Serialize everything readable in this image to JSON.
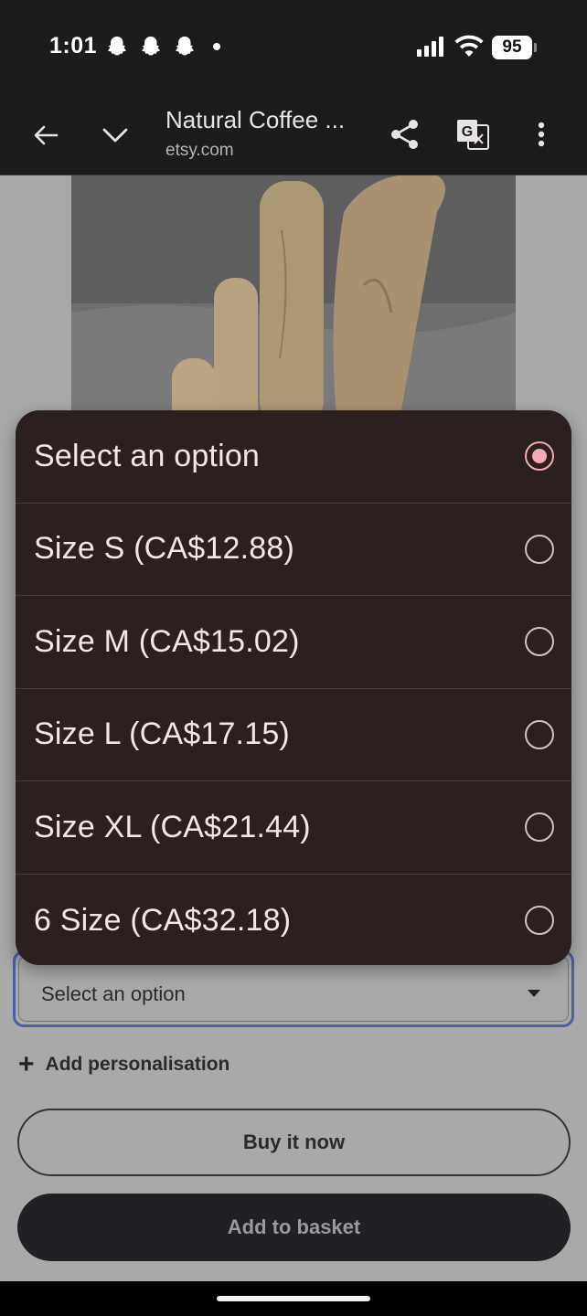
{
  "status_bar": {
    "time": "1:01",
    "battery": "95",
    "icons": [
      "snapchat-icon",
      "snapchat-icon",
      "snapchat-icon",
      "notification-dot",
      "signal-icon",
      "wifi-icon",
      "battery-icon"
    ]
  },
  "browser": {
    "title": "Natural Coffee ...",
    "url": "etsy.com",
    "icons": [
      "back-arrow-icon",
      "chevron-down-icon",
      "share-icon",
      "translate-icon",
      "more-vert-icon"
    ]
  },
  "product": {
    "image": "coffee-wood-sticks-photo"
  },
  "dropdown": {
    "options": [
      {
        "label": "Select an option",
        "selected": true
      },
      {
        "label": "Size S (CA$12.88)",
        "selected": false
      },
      {
        "label": "Size M (CA$15.02)",
        "selected": false
      },
      {
        "label": "Size L (CA$17.15)",
        "selected": false
      },
      {
        "label": "Size XL (CA$21.44)",
        "selected": false
      },
      {
        "label": "6 Size (CA$32.18)",
        "selected": false
      }
    ]
  },
  "select_field": {
    "value": "Select an option"
  },
  "personalisation": {
    "label": "Add personalisation"
  },
  "actions": {
    "buy_now": "Buy it now",
    "add_to_basket": "Add to basket"
  },
  "colors": {
    "sheet_bg": "#2b1f20",
    "radio_accent": "#f2aab4",
    "select_border": "#4a60a6",
    "dim_bg": "#a9a9a9"
  }
}
